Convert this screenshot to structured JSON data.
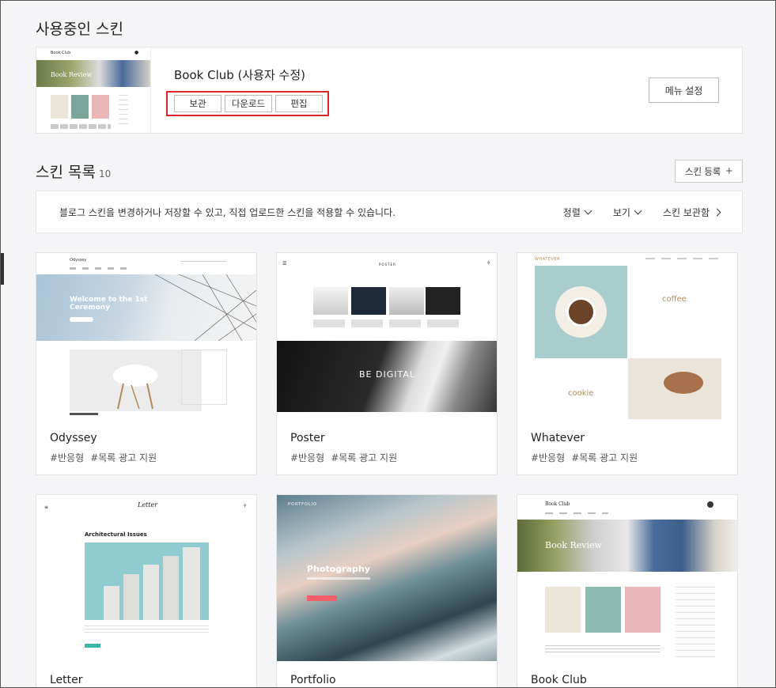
{
  "current_section": {
    "title": "사용중인 스킨",
    "skin_name": "Book Club (사용자 수정)",
    "actions": [
      "보관",
      "다운로드",
      "편집"
    ],
    "menu_settings": "메뉴 설정",
    "thumb": {
      "brand": "Book Club",
      "banner": "Book Review"
    }
  },
  "list_section": {
    "title": "스킨 목록",
    "count": "10",
    "register": "스킨 등록",
    "info_text": "블로그 스킨을 변경하거나 저장할 수 있고, 직접 업로드한 스킨을 적용할 수 있습니다.",
    "sort": "정렬",
    "view": "보기",
    "storage": "스킨 보관함"
  },
  "skins": [
    {
      "name": "Odyssey",
      "tags": [
        "#반응형",
        "#목록 광고 지원"
      ],
      "thumb": {
        "brand": "Odyssey",
        "hero": "Welcome to the 1st Ceremony"
      }
    },
    {
      "name": "Poster",
      "tags": [
        "#반응형",
        "#목록 광고 지원"
      ],
      "thumb": {
        "brand": "POSTER",
        "hero": "BE DIGITAL"
      }
    },
    {
      "name": "Whatever",
      "tags": [
        "#반응형",
        "#목록 광고 지원"
      ],
      "thumb": {
        "brand": "WHATEVER",
        "word1": "coffee",
        "word2": "cookie"
      }
    },
    {
      "name": "Letter",
      "tags": [],
      "thumb": {
        "brand": "Letter",
        "heading": "Architectural Issues"
      }
    },
    {
      "name": "Portfolio",
      "tags": [],
      "thumb": {
        "brand": "PORTFOLIO",
        "hero": "Photography"
      }
    },
    {
      "name": "Book Club",
      "tags": [],
      "thumb": {
        "brand": "Book Club",
        "banner": "Book Review"
      }
    }
  ],
  "colors": {
    "highlight_border": "#d9262c",
    "background": "#f5f5f7"
  }
}
